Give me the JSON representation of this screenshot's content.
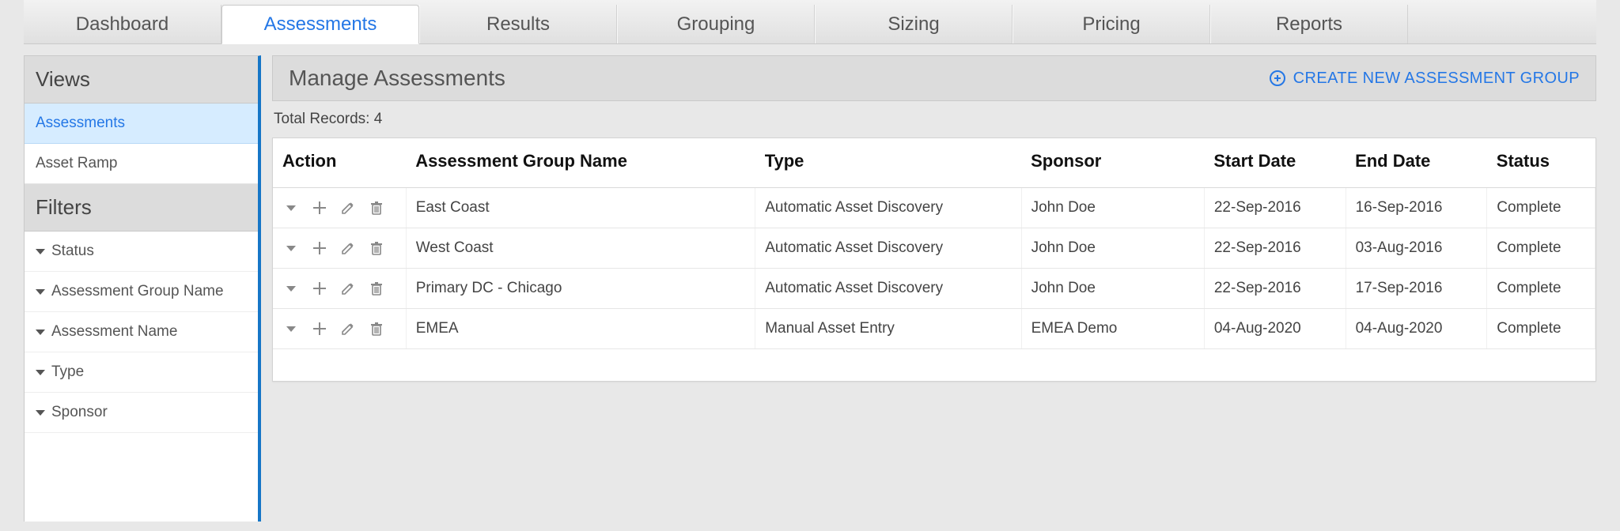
{
  "tabs": [
    {
      "label": "Dashboard",
      "active": false
    },
    {
      "label": "Assessments",
      "active": true
    },
    {
      "label": "Results",
      "active": false
    },
    {
      "label": "Grouping",
      "active": false
    },
    {
      "label": "Sizing",
      "active": false
    },
    {
      "label": "Pricing",
      "active": false
    },
    {
      "label": "Reports",
      "active": false
    }
  ],
  "sidebar": {
    "views_title": "Views",
    "views": [
      {
        "label": "Assessments",
        "selected": true
      },
      {
        "label": "Asset Ramp",
        "selected": false
      }
    ],
    "filters_title": "Filters",
    "filters": [
      {
        "label": "Status"
      },
      {
        "label": "Assessment Group Name"
      },
      {
        "label": "Assessment Name"
      },
      {
        "label": "Type"
      },
      {
        "label": "Sponsor"
      }
    ]
  },
  "main": {
    "title": "Manage Assessments",
    "create_label": "CREATE NEW ASSESSMENT GROUP",
    "total_records_label": "Total Records: 4",
    "columns": {
      "action": "Action",
      "group_name": "Assessment Group Name",
      "type": "Type",
      "sponsor": "Sponsor",
      "start_date": "Start Date",
      "end_date": "End Date",
      "status": "Status"
    },
    "rows": [
      {
        "group_name": "East Coast",
        "type": "Automatic Asset Discovery",
        "sponsor": "John Doe",
        "start_date": "22-Sep-2016",
        "end_date": "16-Sep-2016",
        "status": "Complete"
      },
      {
        "group_name": "West Coast",
        "type": "Automatic Asset Discovery",
        "sponsor": "John Doe",
        "start_date": "22-Sep-2016",
        "end_date": "03-Aug-2016",
        "status": "Complete"
      },
      {
        "group_name": "Primary DC - Chicago",
        "type": "Automatic Asset Discovery",
        "sponsor": "John Doe",
        "start_date": "22-Sep-2016",
        "end_date": "17-Sep-2016",
        "status": "Complete"
      },
      {
        "group_name": "EMEA",
        "type": "Manual Asset Entry",
        "sponsor": "EMEA Demo",
        "start_date": "04-Aug-2020",
        "end_date": "04-Aug-2020",
        "status": "Complete"
      }
    ]
  }
}
